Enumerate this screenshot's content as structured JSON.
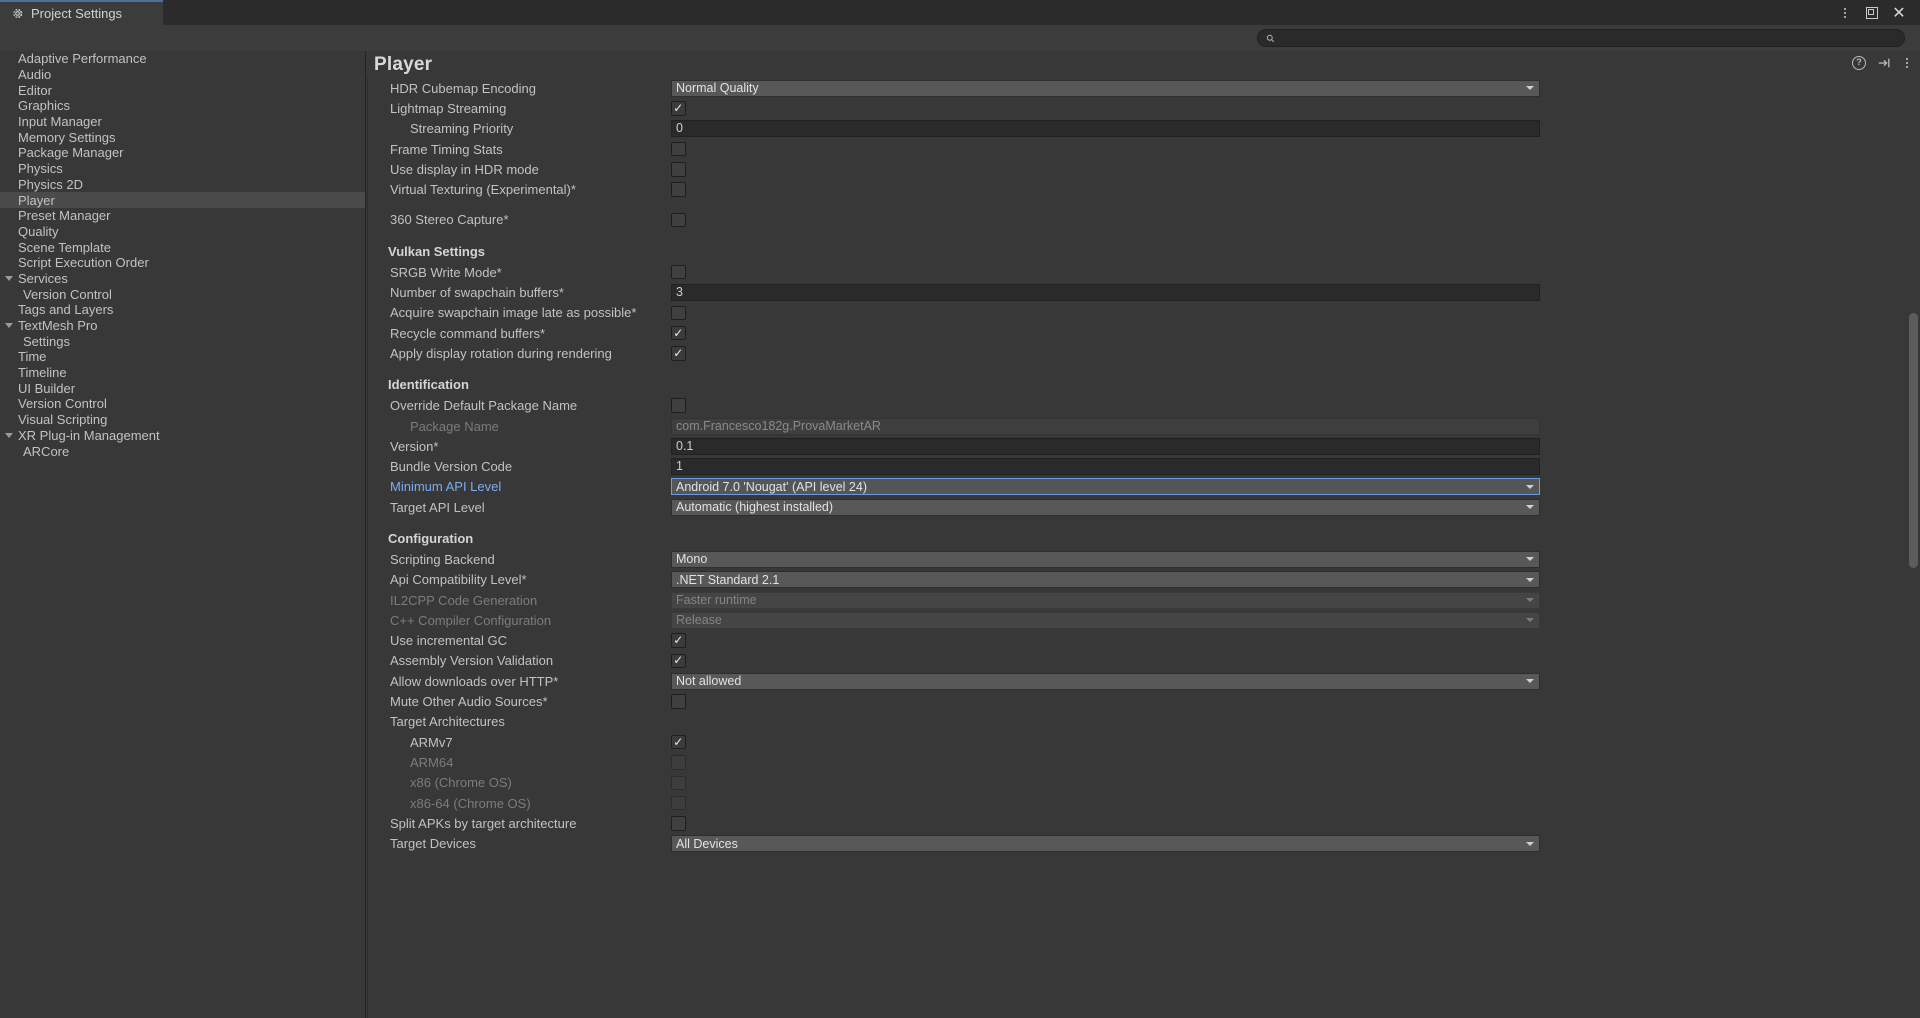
{
  "window": {
    "tab_label": "Project Settings",
    "tab_icon": "gear-icon",
    "controls": [
      "more-options-icon",
      "maximize-icon",
      "close-icon"
    ]
  },
  "search": {
    "value": "",
    "placeholder": "",
    "icon": "search-icon"
  },
  "sidebar": {
    "items": [
      {
        "label": "Adaptive Performance",
        "arrow": false,
        "child": false,
        "selected": false
      },
      {
        "label": "Audio",
        "arrow": false,
        "child": false,
        "selected": false
      },
      {
        "label": "Editor",
        "arrow": false,
        "child": false,
        "selected": false
      },
      {
        "label": "Graphics",
        "arrow": false,
        "child": false,
        "selected": false
      },
      {
        "label": "Input Manager",
        "arrow": false,
        "child": false,
        "selected": false
      },
      {
        "label": "Memory Settings",
        "arrow": false,
        "child": false,
        "selected": false
      },
      {
        "label": "Package Manager",
        "arrow": false,
        "child": false,
        "selected": false
      },
      {
        "label": "Physics",
        "arrow": false,
        "child": false,
        "selected": false
      },
      {
        "label": "Physics 2D",
        "arrow": false,
        "child": false,
        "selected": false
      },
      {
        "label": "Player",
        "arrow": false,
        "child": false,
        "selected": true
      },
      {
        "label": "Preset Manager",
        "arrow": false,
        "child": false,
        "selected": false
      },
      {
        "label": "Quality",
        "arrow": false,
        "child": false,
        "selected": false
      },
      {
        "label": "Scene Template",
        "arrow": false,
        "child": false,
        "selected": false
      },
      {
        "label": "Script Execution Order",
        "arrow": false,
        "child": false,
        "selected": false
      },
      {
        "label": "Services",
        "arrow": true,
        "child": false,
        "selected": false
      },
      {
        "label": "Version Control",
        "arrow": false,
        "child": true,
        "selected": false
      },
      {
        "label": "Tags and Layers",
        "arrow": false,
        "child": false,
        "selected": false
      },
      {
        "label": "TextMesh Pro",
        "arrow": true,
        "child": false,
        "selected": false
      },
      {
        "label": "Settings",
        "arrow": false,
        "child": true,
        "selected": false
      },
      {
        "label": "Time",
        "arrow": false,
        "child": false,
        "selected": false
      },
      {
        "label": "Timeline",
        "arrow": false,
        "child": false,
        "selected": false
      },
      {
        "label": "UI Builder",
        "arrow": false,
        "child": false,
        "selected": false
      },
      {
        "label": "Version Control",
        "arrow": false,
        "child": false,
        "selected": false
      },
      {
        "label": "Visual Scripting",
        "arrow": false,
        "child": false,
        "selected": false
      },
      {
        "label": "XR Plug-in Management",
        "arrow": true,
        "child": false,
        "selected": false
      },
      {
        "label": "ARCore",
        "arrow": false,
        "child": true,
        "selected": false
      }
    ]
  },
  "main": {
    "title": "Player",
    "header_icons": [
      "help-icon",
      "preset-icon",
      "more-options-icon"
    ],
    "rows": [
      {
        "kind": "dropdown",
        "label": "HDR Cubemap Encoding",
        "indent": 1,
        "value": "Normal Quality"
      },
      {
        "kind": "checkbox",
        "label": "Lightmap Streaming",
        "indent": 1,
        "checked": true
      },
      {
        "kind": "text",
        "label": "Streaming Priority",
        "indent": 2,
        "value": "0"
      },
      {
        "kind": "checkbox",
        "label": "Frame Timing Stats",
        "indent": 1,
        "checked": false
      },
      {
        "kind": "checkbox",
        "label": "Use display in HDR mode",
        "indent": 1,
        "checked": false
      },
      {
        "kind": "checkbox",
        "label": "Virtual Texturing (Experimental)*",
        "indent": 1,
        "checked": false
      },
      {
        "kind": "spacer"
      },
      {
        "kind": "checkbox",
        "label": "360 Stereo Capture*",
        "indent": 1,
        "checked": false
      },
      {
        "kind": "spacer"
      },
      {
        "kind": "section",
        "label": "Vulkan Settings"
      },
      {
        "kind": "checkbox",
        "label": "SRGB Write Mode*",
        "indent": 1,
        "checked": false
      },
      {
        "kind": "text",
        "label": "Number of swapchain buffers*",
        "indent": 1,
        "value": "3"
      },
      {
        "kind": "checkbox",
        "label": "Acquire swapchain image late as possible*",
        "indent": 1,
        "checked": false
      },
      {
        "kind": "checkbox",
        "label": "Recycle command buffers*",
        "indent": 1,
        "checked": true
      },
      {
        "kind": "checkbox",
        "label": "Apply display rotation during rendering",
        "indent": 1,
        "checked": true
      },
      {
        "kind": "spacer"
      },
      {
        "kind": "section",
        "label": "Identification"
      },
      {
        "kind": "checkbox",
        "label": "Override Default Package Name",
        "indent": 1,
        "checked": false
      },
      {
        "kind": "text",
        "label": "Package Name",
        "indent": 2,
        "value": "com.Francesco182g.ProvaMarketAR",
        "disabled": true
      },
      {
        "kind": "text",
        "label": "Version*",
        "indent": 1,
        "value": "0.1"
      },
      {
        "kind": "text",
        "label": "Bundle Version Code",
        "indent": 1,
        "value": "1"
      },
      {
        "kind": "dropdown",
        "label": "Minimum API Level",
        "indent": 1,
        "value": "Android 7.0 'Nougat' (API level 24)",
        "focused": true
      },
      {
        "kind": "dropdown",
        "label": "Target API Level",
        "indent": 1,
        "value": "Automatic (highest installed)"
      },
      {
        "kind": "spacer"
      },
      {
        "kind": "section",
        "label": "Configuration"
      },
      {
        "kind": "dropdown",
        "label": "Scripting Backend",
        "indent": 1,
        "value": "Mono"
      },
      {
        "kind": "dropdown",
        "label": "Api Compatibility Level*",
        "indent": 1,
        "value": ".NET Standard 2.1"
      },
      {
        "kind": "dropdown",
        "label": "IL2CPP Code Generation",
        "indent": 1,
        "value": "Faster runtime",
        "disabled": true
      },
      {
        "kind": "dropdown",
        "label": "C++ Compiler Configuration",
        "indent": 1,
        "value": "Release",
        "disabled": true
      },
      {
        "kind": "checkbox",
        "label": "Use incremental GC",
        "indent": 1,
        "checked": true
      },
      {
        "kind": "checkbox",
        "label": "Assembly Version Validation",
        "indent": 1,
        "checked": true
      },
      {
        "kind": "dropdown",
        "label": "Allow downloads over HTTP*",
        "indent": 1,
        "value": "Not allowed"
      },
      {
        "kind": "checkbox",
        "label": "Mute Other Audio Sources*",
        "indent": 1,
        "checked": false
      },
      {
        "kind": "plain",
        "label": "Target Architectures",
        "indent": 1
      },
      {
        "kind": "checkbox",
        "label": "ARMv7",
        "indent": 2,
        "checked": true
      },
      {
        "kind": "checkbox",
        "label": "ARM64",
        "indent": 2,
        "checked": false,
        "disabled": true
      },
      {
        "kind": "checkbox",
        "label": "x86 (Chrome OS)",
        "indent": 2,
        "checked": false,
        "disabled": true
      },
      {
        "kind": "checkbox",
        "label": "x86-64 (Chrome OS)",
        "indent": 2,
        "checked": false,
        "disabled": true
      },
      {
        "kind": "checkbox",
        "label": "Split APKs by target architecture",
        "indent": 1,
        "checked": false
      },
      {
        "kind": "dropdown",
        "label": "Target Devices",
        "indent": 1,
        "value": "All Devices"
      }
    ]
  }
}
